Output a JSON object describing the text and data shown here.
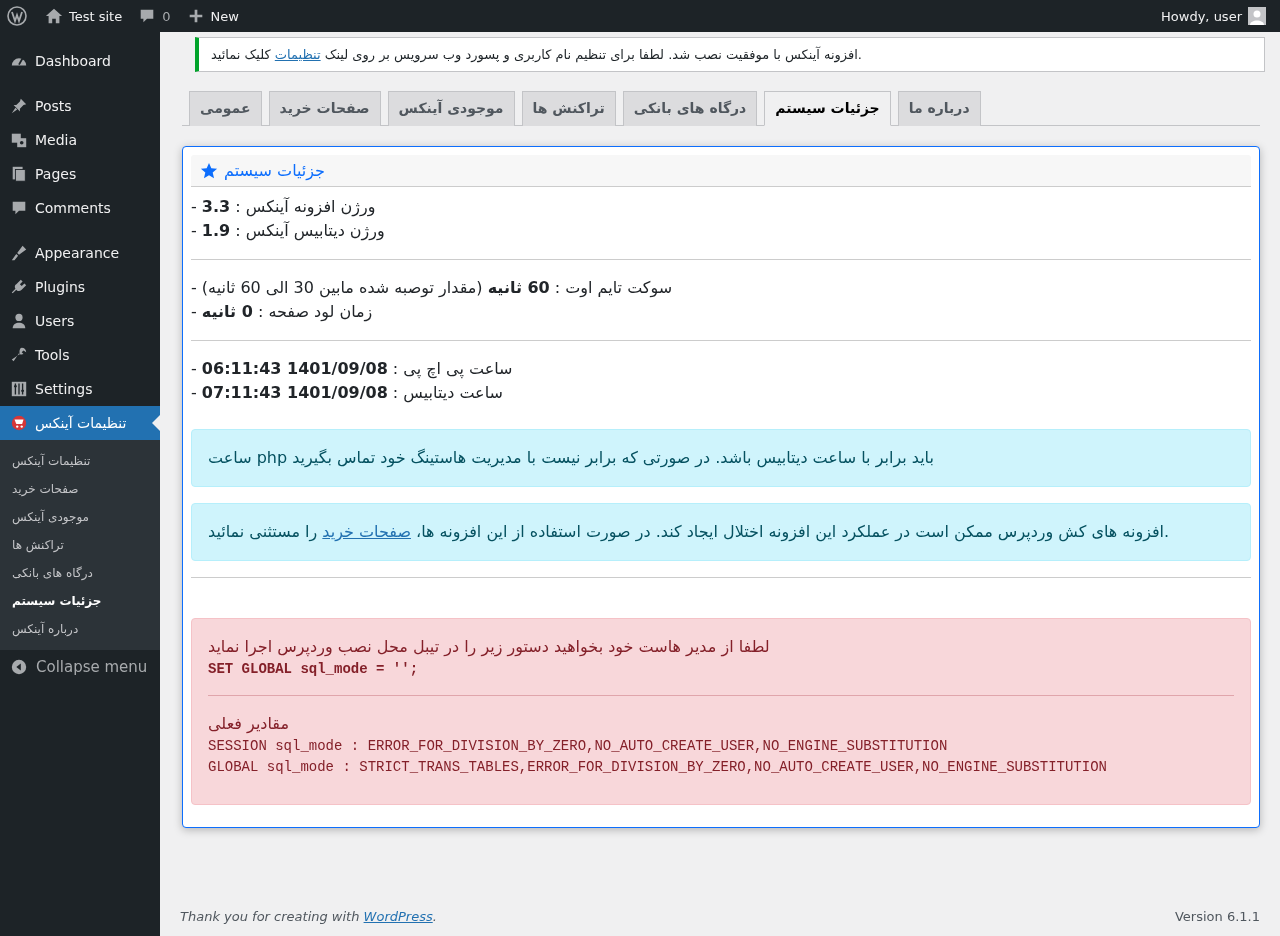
{
  "admin_bar": {
    "site": "Test site",
    "comments": "0",
    "new": "New",
    "greeting": "Howdy, user"
  },
  "sidebar": {
    "items": [
      {
        "label": "Dashboard",
        "selected": false
      },
      {
        "label": "Posts",
        "selected": false
      },
      {
        "label": "Media",
        "selected": false
      },
      {
        "label": "Pages",
        "selected": false
      },
      {
        "label": "Comments",
        "selected": false
      },
      {
        "label": "Appearance",
        "selected": false
      },
      {
        "label": "Plugins",
        "selected": false
      },
      {
        "label": "Users",
        "selected": false
      },
      {
        "label": "Tools",
        "selected": false
      },
      {
        "label": "Settings",
        "selected": false
      },
      {
        "label": "تنظیمات آینکس",
        "selected": true
      }
    ],
    "submenu": [
      {
        "label": "تنظیمات آینکس",
        "selected": false
      },
      {
        "label": "صفحات خرید",
        "selected": false
      },
      {
        "label": "موجودی آینکس",
        "selected": false
      },
      {
        "label": "تراکنش ها",
        "selected": false
      },
      {
        "label": "درگاه های بانکی",
        "selected": false
      },
      {
        "label": "جزئیات سیستم",
        "selected": true
      },
      {
        "label": "درباره آینکس",
        "selected": false
      }
    ],
    "collapse": "Collapse menu"
  },
  "notice": {
    "parts": [
      {
        "kind": "text",
        "text": ".افزونه آینکس با موفقیت نصب شد. لطفا برای تنظیم نام کاربری و پسورد وب سرویس بر روی لینک "
      },
      {
        "kind": "link",
        "text": "تنظیمات"
      },
      {
        "kind": "text",
        "text": " کلیک نمائید"
      }
    ]
  },
  "tabs": [
    {
      "label": "درباره ما",
      "selected": false
    },
    {
      "label": "جزئیات سیستم",
      "selected": true
    },
    {
      "label": "درگاه های بانکی",
      "selected": false
    },
    {
      "label": "تراکنش ها",
      "selected": false
    },
    {
      "label": "موجودی آینکس",
      "selected": false
    },
    {
      "label": "صفحات خرید",
      "selected": false
    },
    {
      "label": "عمومی",
      "selected": false
    }
  ],
  "panel": {
    "title": "جزئیات سیستم",
    "groups": [
      [
        "ورژن افزونه آینکس : **3.3** -",
        "ورژن دیتابیس آینکس : **1.9** -"
      ],
      [
        "سوکت تایم اوت : **60 ثانیه** (مقدار توصبه شده مابین 30 الی 60 ثانیه) -",
        "زمان لود صفحه : **0 ثانیه** -"
      ],
      [
        "ساعت پی اچ پی : **1401/09/08 06:11:43** -",
        "ساعت دیتابیس : **1401/09/08 07:11:43** -"
      ]
    ],
    "notes": [
      {
        "parts": [
          {
            "kind": "text",
            "text": "ساعت php باید برابر با ساعت دیتابیس باشد. در صورتی که برابر نیست با مدیریت هاستینگ خود تماس بگیرید"
          }
        ]
      },
      {
        "parts": [
          {
            "kind": "text",
            "text": ".افزونه های کش وردپرس ممکن است در عملکرد این افزونه اختلال ایجاد کند. در صورت استفاده از این افزونه ها، "
          },
          {
            "kind": "link",
            "text": "صفحات خرید"
          },
          {
            "kind": "text",
            "text": " را مستثنی نمائید"
          }
        ]
      }
    ],
    "alert": {
      "message": "لطفا از مدیر هاست خود بخواهید دستور زیر را در تیبل محل نصب وردپرس اجرا نماید",
      "command": "SET GLOBAL sql_mode = '';",
      "current_title": "مقادیر فعلی",
      "values": [
        "SESSION sql_mode : ERROR_FOR_DIVISION_BY_ZERO,NO_AUTO_CREATE_USER,NO_ENGINE_SUBSTITUTION",
        "GLOBAL sql_mode : STRICT_TRANS_TABLES,ERROR_FOR_DIVISION_BY_ZERO,NO_AUTO_CREATE_USER,NO_ENGINE_SUBSTITUTION"
      ]
    }
  },
  "footer": {
    "before": "Thank you for creating with ",
    "link": "WordPress",
    "after": ".",
    "version": "Version 6.1.1"
  }
}
